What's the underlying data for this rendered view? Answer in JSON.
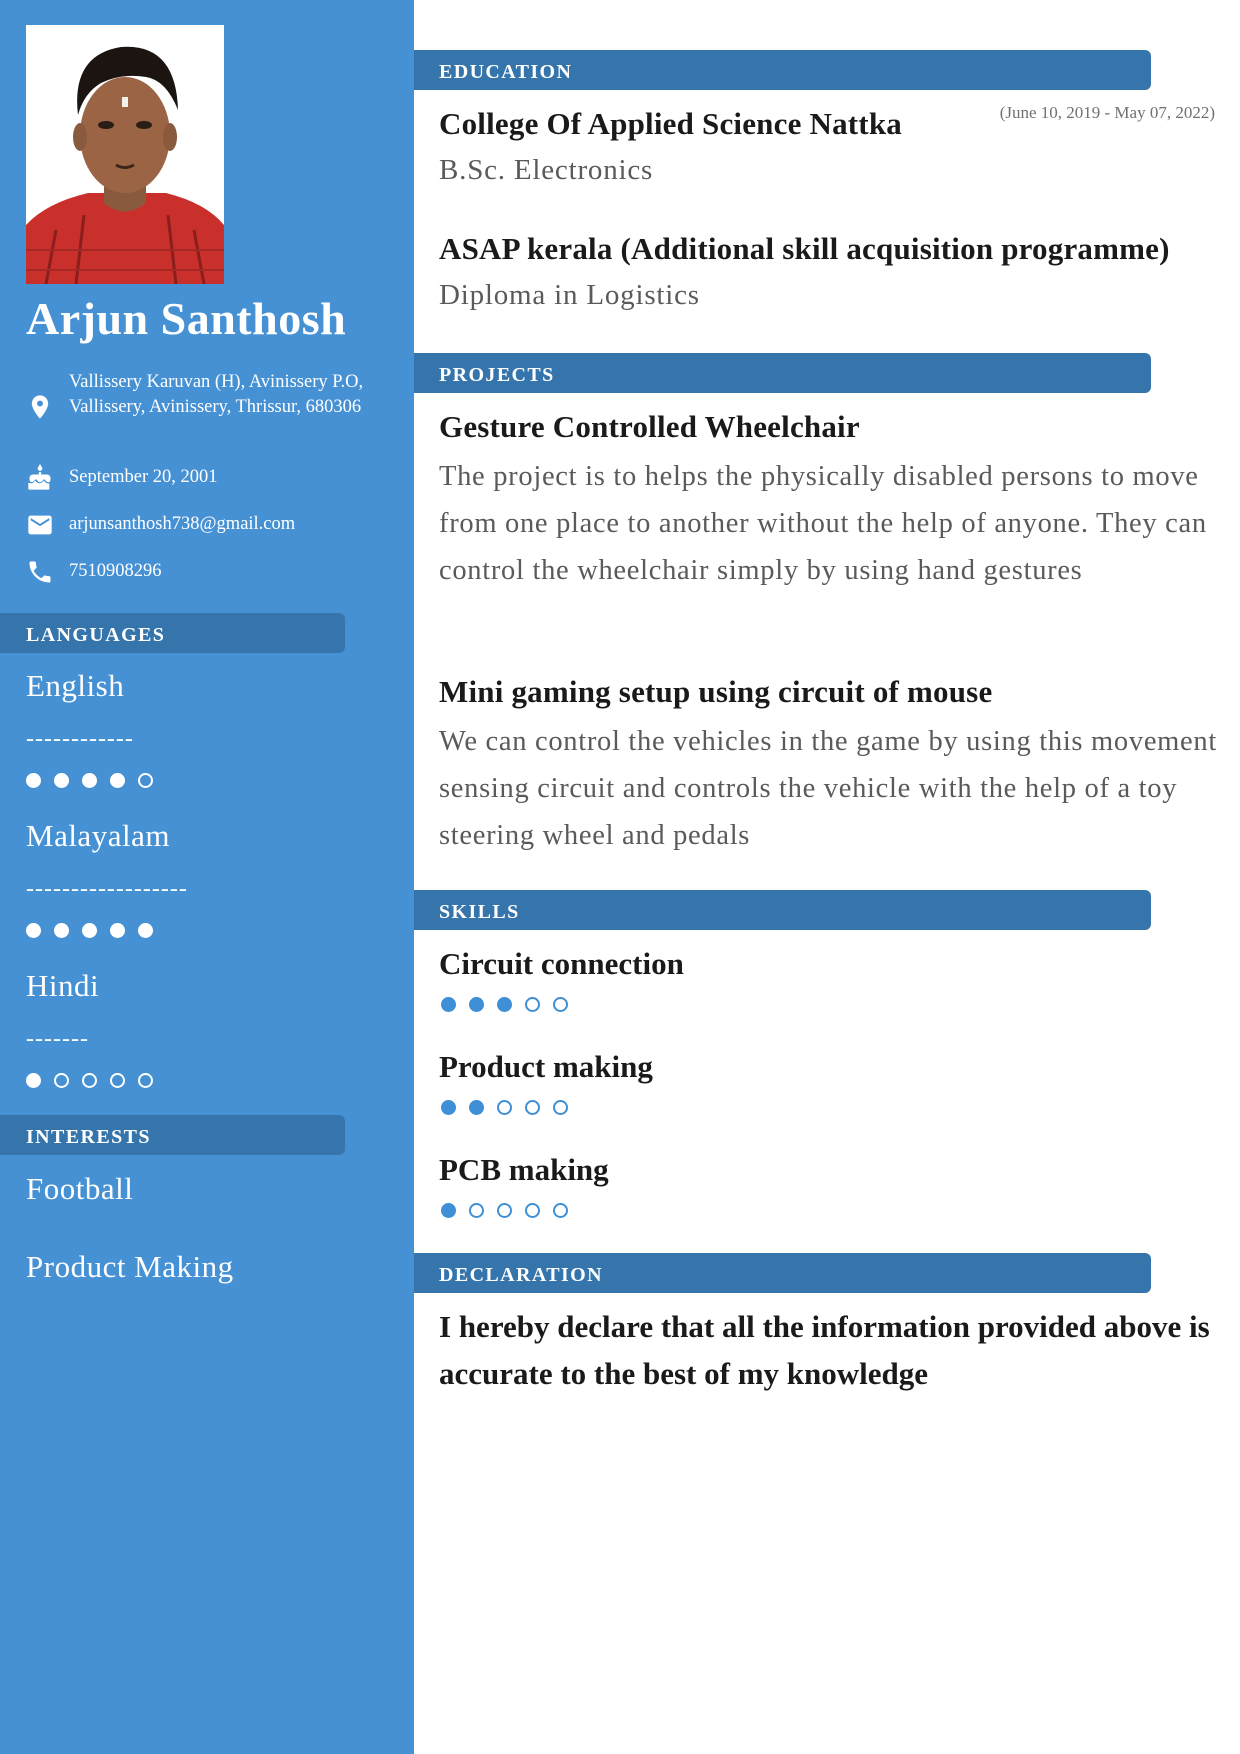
{
  "profile": {
    "name": "Arjun Santhosh",
    "address": "Vallissery Karuvan (H), Avinissery P.O, Vallissery, Avinissery, Thrissur, 680306",
    "birthdate": "September 20, 2001",
    "email": "arjunsanthosh738@gmail.com",
    "phone": "7510908296"
  },
  "languages": {
    "header": "LANGUAGES",
    "items": [
      {
        "name": "English",
        "dashes": "------------",
        "rating": 4,
        "max": 5
      },
      {
        "name": "Malayalam",
        "dashes": "------------------",
        "rating": 5,
        "max": 5
      },
      {
        "name": "Hindi",
        "dashes": "-------",
        "rating": 1,
        "max": 5
      }
    ]
  },
  "interests": {
    "header": "INTERESTS",
    "items": [
      "Football",
      "Product Making"
    ]
  },
  "education": {
    "header": "EDUCATION",
    "items": [
      {
        "institution": "College Of Applied Science Nattka",
        "degree": "B.Sc. Electronics",
        "dates": "(June 10, 2019 - May 07, 2022)"
      },
      {
        "institution": "ASAP kerala (Additional skill acquisition programme)",
        "degree": "Diploma in Logistics"
      }
    ]
  },
  "projects": {
    "header": "PROJECTS",
    "items": [
      {
        "title": "Gesture Controlled Wheelchair",
        "description": "The project is to helps the physically disabled persons to move from one place to another without the help of anyone. They can control the wheelchair simply by using hand gestures"
      },
      {
        "title": "Mini gaming setup using circuit of mouse",
        "description": "We can control the vehicles in the game by using this movement sensing circuit and controls the vehicle with the help of a toy steering wheel and pedals"
      }
    ]
  },
  "skills": {
    "header": "SKILLS",
    "items": [
      {
        "name": "Circuit connection",
        "rating": 3,
        "max": 5
      },
      {
        "name": "Product making",
        "rating": 2,
        "max": 5
      },
      {
        "name": "PCB making",
        "rating": 1,
        "max": 5
      }
    ]
  },
  "declaration": {
    "header": "DECLARATION",
    "text": "I hereby declare that all the information provided above is accurate to the best of my knowledge"
  },
  "colors": {
    "sidebar": "#4691d4",
    "header_bar": "#3675ab",
    "rating_blue": "#3f8fd6"
  }
}
